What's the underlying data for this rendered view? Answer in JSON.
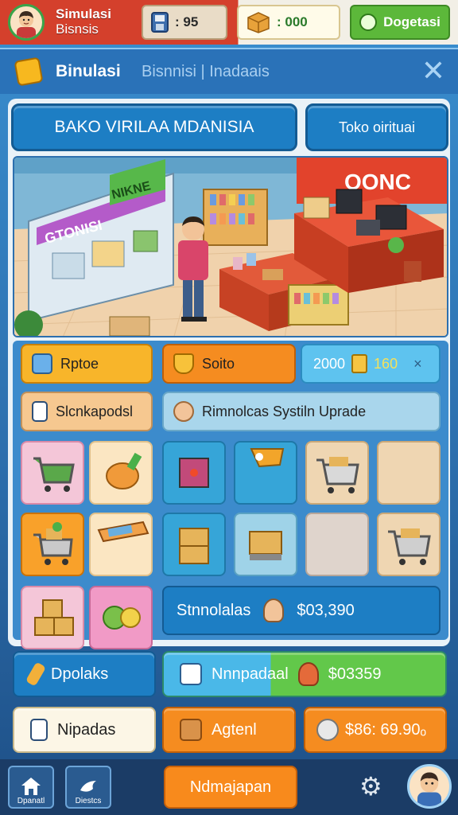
{
  "topbar": {
    "title_line1": "Simulasi",
    "title_line2": "Bisnsis",
    "cash_value": ": 95",
    "stock_value": ": 000",
    "done_label": "Dogetasi"
  },
  "header": {
    "title": "Binulasi",
    "subtitle": "Bisnnisi  |  Inadaais"
  },
  "store_name_button": "BAKO VIRILAA  MDANISIA",
  "store_shop_button": "Toko oirituai",
  "scene": {
    "sign_left": "GTONISI",
    "sign_green": "NIKNE",
    "sign_right": "OONC"
  },
  "tabs": {
    "tab1": "Rptoe",
    "tab2": "Soito",
    "counter": "2000",
    "counter2": "160",
    "counter_close": "×",
    "tab4": "Slcnkapodsl",
    "tab5": "Rimnolcas  Systiln Uprade"
  },
  "summary_row": {
    "label": "Stnnolalas",
    "value": "$03,390"
  },
  "actions": {
    "a1": "Dpolaks",
    "a2": "Nnnpadaal",
    "a2_value": "$03359",
    "a3": "Nipadas",
    "a4": "Agtenl",
    "a5": "$86: 69.90ₒ"
  },
  "nav": {
    "home_label": "Dpanatl",
    "store_label": "Diestcs",
    "main_label": "Ndmajapan"
  },
  "colors": {
    "accent_red": "#d4402c",
    "accent_blue": "#1d7ec4",
    "accent_orange": "#f88a1c",
    "accent_green": "#5cb83a"
  }
}
